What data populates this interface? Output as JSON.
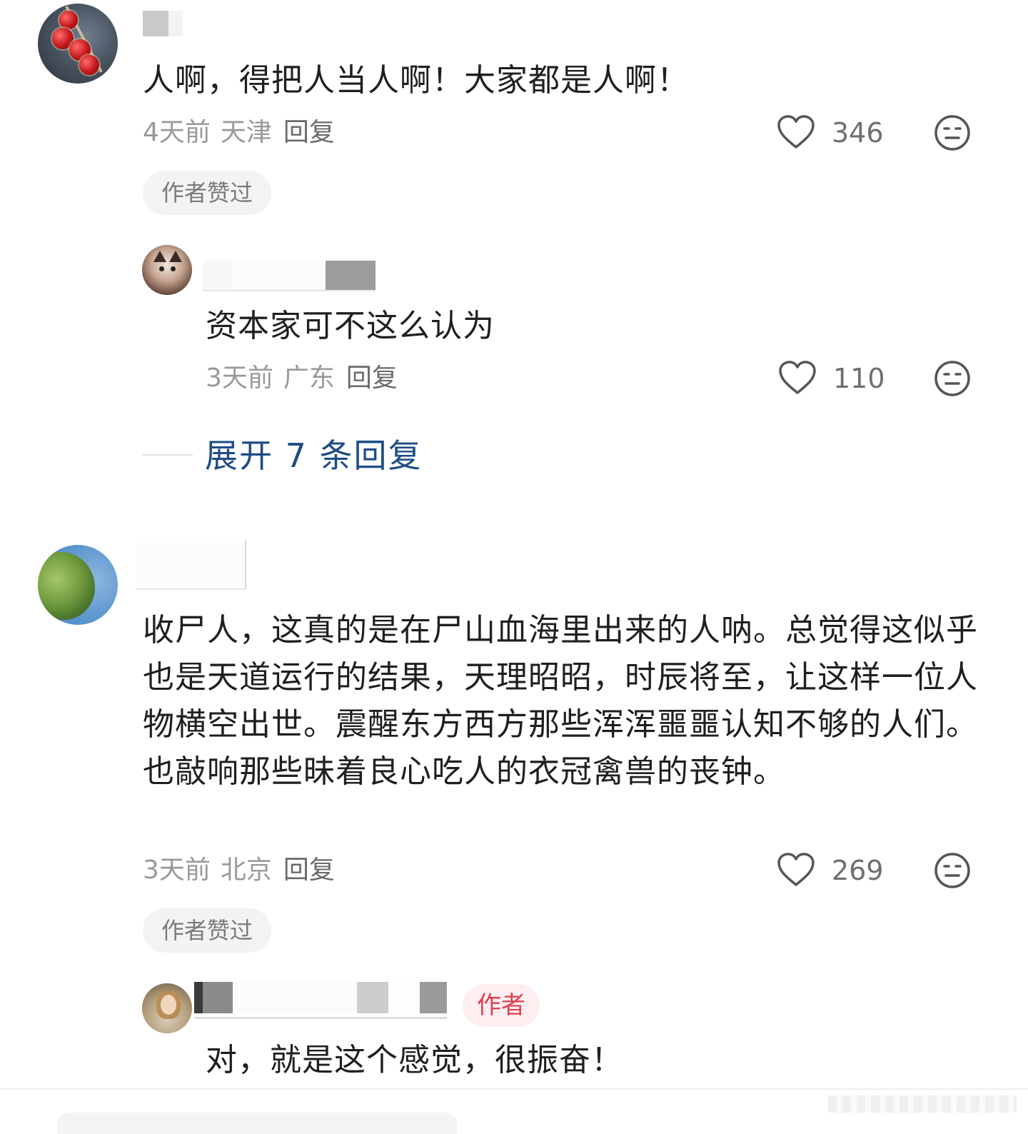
{
  "comments": [
    {
      "text": "人啊，得把人当人啊！大家都是人啊！",
      "time": "4天前",
      "location": "天津",
      "reply_label": "回复",
      "likes": "346",
      "badge": "作者赞过",
      "replies": [
        {
          "text": "资本家可不这么认为",
          "time": "3天前",
          "location": "广东",
          "reply_label": "回复",
          "likes": "110"
        }
      ],
      "expand_label": "展开 7 条回复"
    },
    {
      "text": "收尸人，这真的是在尸山血海里出来的人呐。总觉得这似乎也是天道运行的结果，天理昭昭，时辰将至，让这样一位人物横空出世。震醒东方西方那些浑浑噩噩认知不够的人们。也敲响那些昧着良心吃人的衣冠禽兽的丧钟。",
      "time": "3天前",
      "location": "北京",
      "reply_label": "回复",
      "likes": "269",
      "badge": "作者赞过",
      "replies": [
        {
          "author_tag": "作者",
          "text": "对，就是这个感觉，很振奋！"
        }
      ]
    }
  ],
  "icons": {
    "like": "heart-outline-icon",
    "dislike": "meh-face-icon"
  },
  "colors": {
    "link": "#1e4c86",
    "author_tag_text": "#e0404f",
    "author_tag_bg": "#fdeef0",
    "meta": "#9a9a9a"
  }
}
